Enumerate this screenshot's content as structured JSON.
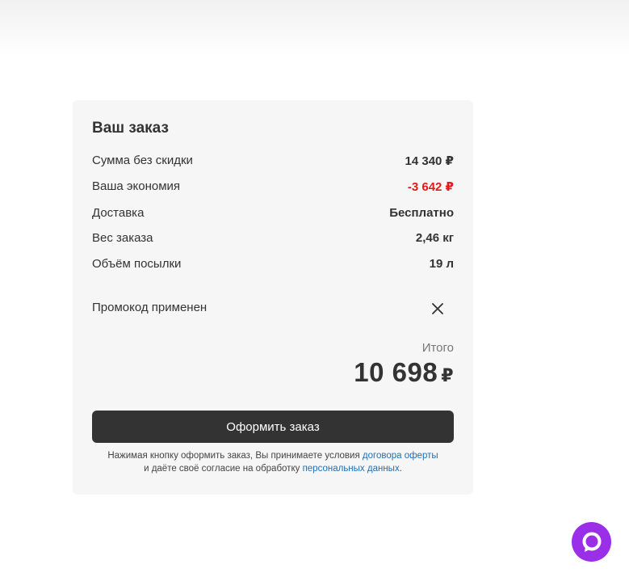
{
  "order": {
    "title": "Ваш заказ",
    "rows": [
      {
        "label": "Сумма без скидки",
        "value": "14 340 ₽"
      },
      {
        "label": "Ваша экономия",
        "value": "-3 642 ₽"
      },
      {
        "label": "Доставка",
        "value": "Бесплатно"
      },
      {
        "label": "Вес заказа",
        "value": "2,46 кг"
      },
      {
        "label": "Объём посылки",
        "value": "19 л"
      }
    ],
    "promo_label": "Промокод применен",
    "total_label": "Итого",
    "total_amount": "10 698",
    "currency": "₽",
    "button_label": "Оформить заказ",
    "terms": {
      "line1_text": "Нажимая кнопку оформить заказ, Вы принимаете условия ",
      "line1_link": "договора оферты",
      "line2_text": "и даёте своё согласие на обработку ",
      "line2_link": "персональных данных",
      "line2_end": "."
    }
  },
  "icons": {
    "close": "close-icon",
    "chat": "chat-icon"
  },
  "colors": {
    "discount": "#e21a1a",
    "button_bg": "#333333",
    "link": "#1f6fb2",
    "chat_bg": "#9b2fe8"
  }
}
